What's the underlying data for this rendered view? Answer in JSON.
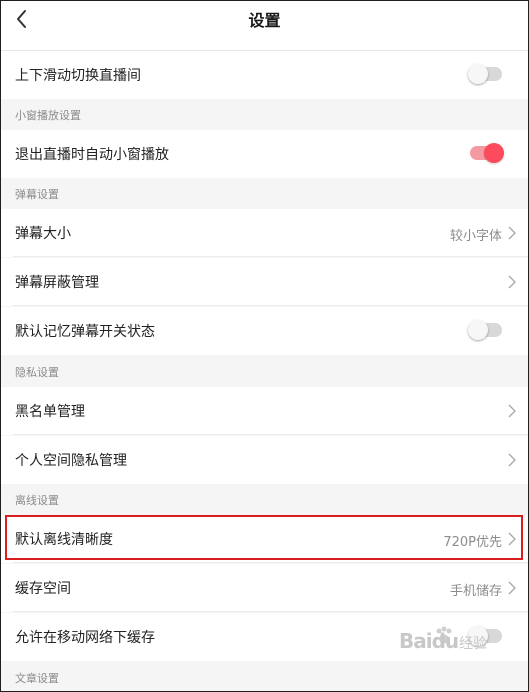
{
  "header": {
    "title": "设置",
    "back_icon": "chevron-left-icon"
  },
  "rows": {
    "swipe_switch": {
      "label": "上下滑动切换直播间",
      "toggle_on": false
    },
    "pip_exit": {
      "label": "退出直播时自动小窗播放",
      "toggle_on": true
    },
    "danmaku_size": {
      "label": "弹幕大小",
      "value": "较小字体"
    },
    "danmaku_block": {
      "label": "弹幕屏蔽管理"
    },
    "danmaku_remember": {
      "label": "默认记忆弹幕开关状态",
      "toggle_on": false
    },
    "blacklist": {
      "label": "黑名单管理"
    },
    "space_privacy": {
      "label": "个人空间隐私管理"
    },
    "offline_quality": {
      "label": "默认离线清晰度",
      "value": "720P优先"
    },
    "cache_space": {
      "label": "缓存空间",
      "value": "手机储存"
    },
    "mobile_cache": {
      "label": "允许在移动网络下缓存",
      "toggle_on": false
    }
  },
  "sections": {
    "pip": "小窗播放设置",
    "danmaku": "弹幕设置",
    "privacy": "隐私设置",
    "offline": "离线设置",
    "article": "文章设置"
  },
  "watermark": {
    "brand": "Baidu",
    "sub": "经验"
  },
  "colors": {
    "accent": "#fb4b5c",
    "highlight_box": "#d81e1e"
  }
}
